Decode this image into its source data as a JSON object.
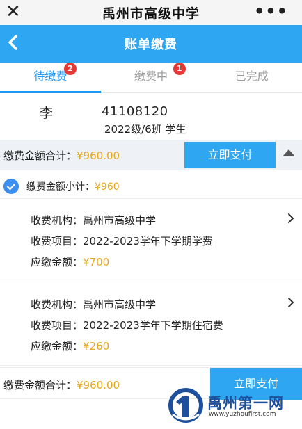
{
  "topbar": {
    "title": "禹州市高级中学",
    "close_icon": "close-icon",
    "more_icon": "more-icon",
    "more_glyph": "•••"
  },
  "header": {
    "title": "账单缴费",
    "back_icon": "chevron-left-icon"
  },
  "tabs": [
    {
      "label": "待缴费",
      "badge": "2",
      "active": true
    },
    {
      "label": "缴费中",
      "badge": "1",
      "active": false
    },
    {
      "label": "已完成",
      "badge": "",
      "active": false
    }
  ],
  "student": {
    "name": "李",
    "id": "41108120",
    "class": "2022级/6班 学生"
  },
  "summary": {
    "label": "缴费金额合计：",
    "amount": "¥960.00",
    "pay_button": "立即支付"
  },
  "subtotal": {
    "label": "缴费金额小计：",
    "amount": "¥960"
  },
  "items": [
    {
      "org_label": "收费机构：",
      "org": "禹州市高级中学",
      "project_label": "收费项目：",
      "project": "2022-2023学年下学期学费",
      "due_label": "应缴金额：",
      "due": "¥700"
    },
    {
      "org_label": "收费机构：",
      "org": "禹州市高级中学",
      "project_label": "收费项目：",
      "project": "2022-2023学年下学期住宿费",
      "due_label": "应缴金额：",
      "due": "¥260"
    }
  ],
  "bottom": {
    "label": "缴费金额合计：",
    "amount": "¥960.00",
    "pay_button": "立即支付"
  },
  "watermark": {
    "name": "禹州第一网",
    "url": "www.yuzhoufirst.com"
  },
  "colors": {
    "accent": "#2ea6f2",
    "amount": "#e6a817",
    "badge": "#e53935"
  }
}
